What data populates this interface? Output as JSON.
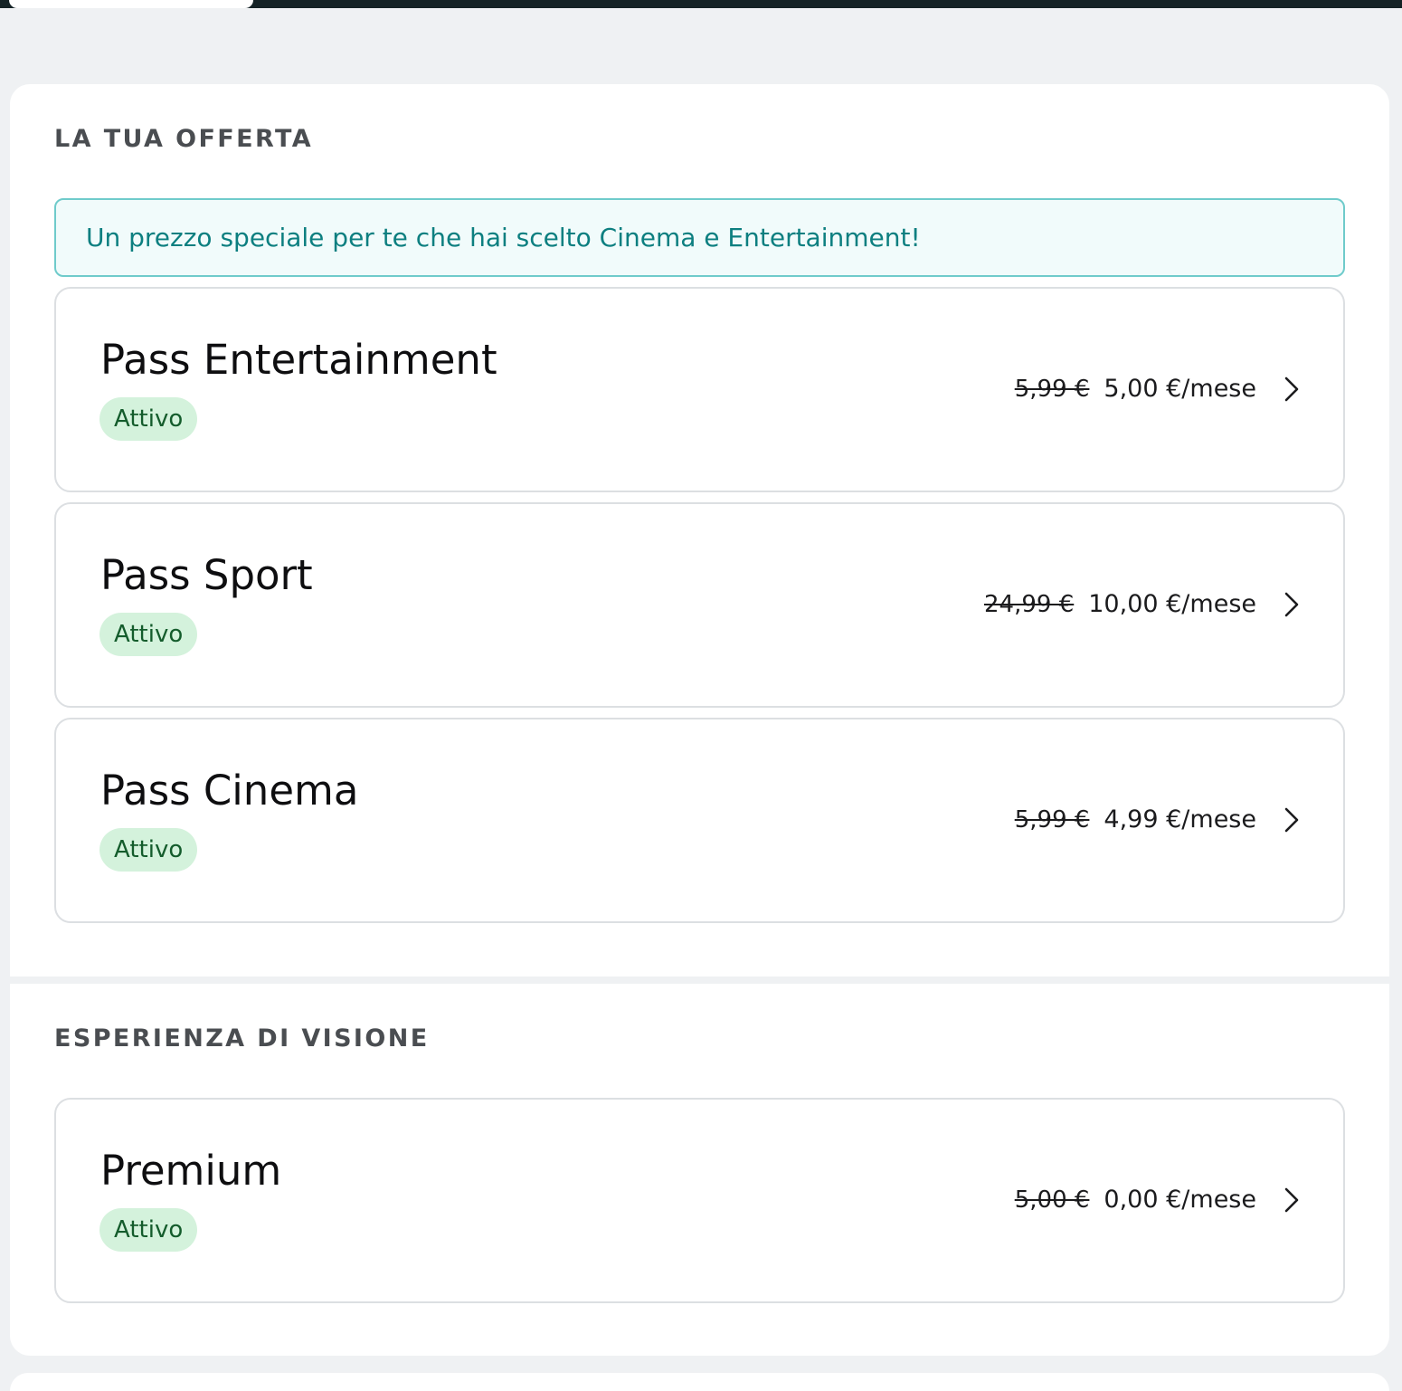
{
  "offer_section": {
    "title": "LA TUA OFFERTA",
    "promo_banner": "Un prezzo speciale per te che hai scelto Cinema e Entertainment!",
    "items": [
      {
        "name": "Pass Entertainment",
        "status": "Attivo",
        "old_price": "5,99 €",
        "price": "5,00 €/mese"
      },
      {
        "name": "Pass Sport",
        "status": "Attivo",
        "old_price": "24,99 €",
        "price": "10,00 €/mese"
      },
      {
        "name": "Pass Cinema",
        "status": "Attivo",
        "old_price": "5,99 €",
        "price": "4,99 €/mese"
      }
    ]
  },
  "vision_section": {
    "title": "ESPERIENZA DI VISIONE",
    "items": [
      {
        "name": "Premium",
        "status": "Attivo",
        "old_price": "5,00 €",
        "price": "0,00 €/mese"
      }
    ]
  },
  "colors": {
    "page_background": "#eff1f3",
    "top_bar": "#152326",
    "promo_text": "#0d7f80",
    "promo_border": "#6fcbcb",
    "badge_background": "#d4f2dc",
    "badge_text": "#145c2c"
  },
  "icons": {
    "card_chevron": "chevron-right-icon"
  }
}
